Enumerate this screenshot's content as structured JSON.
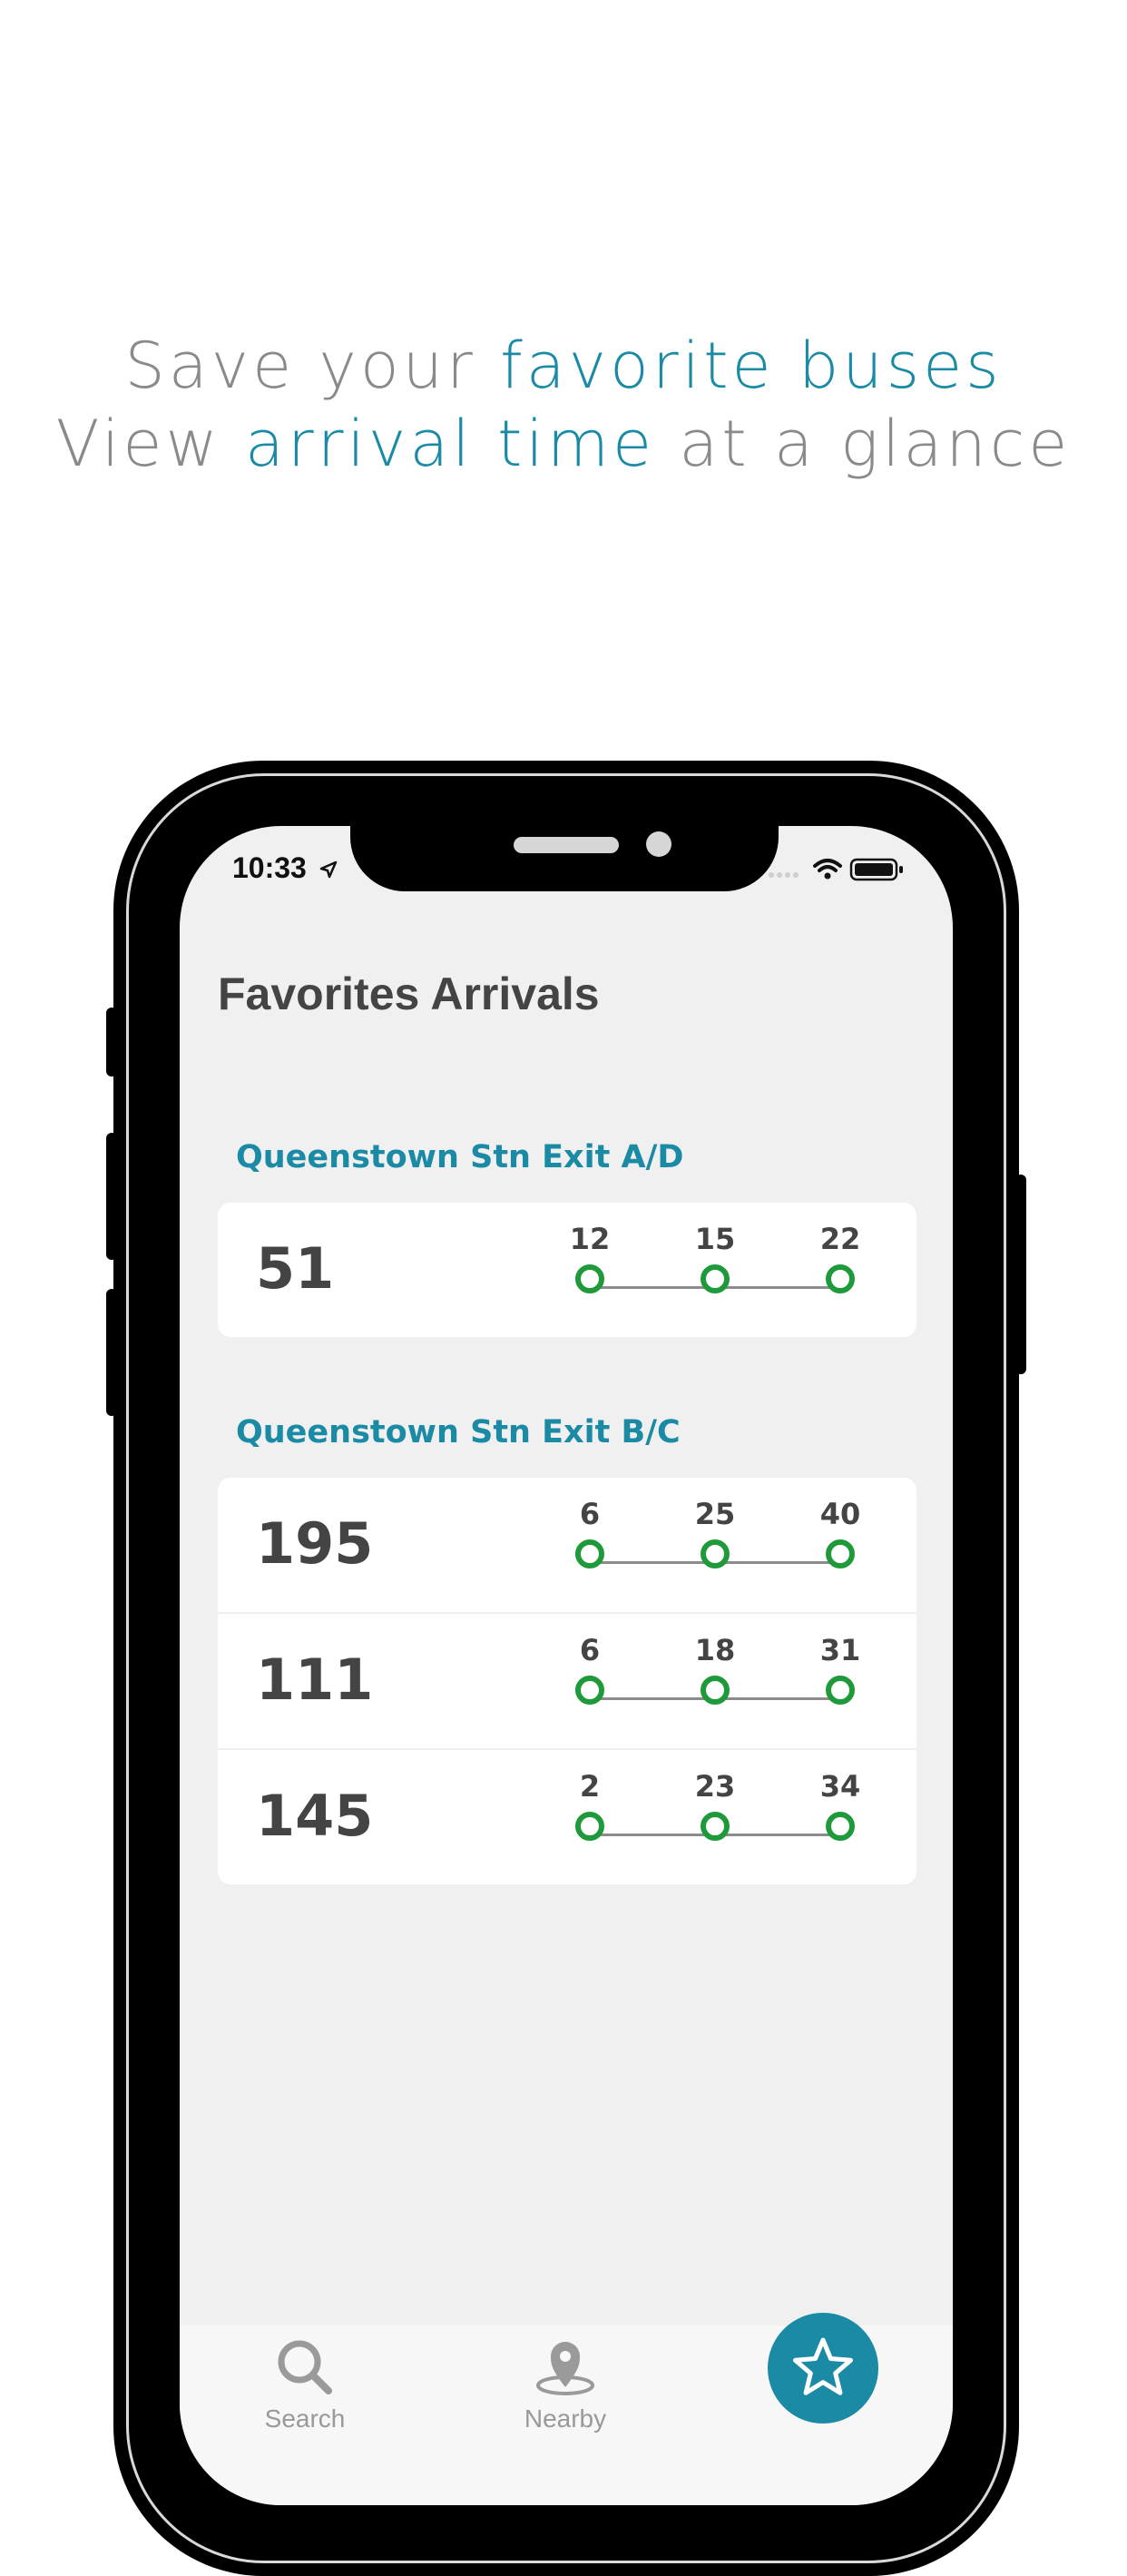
{
  "headline": {
    "line1_pre": "Save your ",
    "line1_hl": "favorite buses",
    "line2_pre": "View ",
    "line2_hl": "arrival time",
    "line2_post": " at a glance"
  },
  "status_bar": {
    "time": "10:33"
  },
  "screen": {
    "title": "Favorites Arrivals",
    "groups": [
      {
        "label": "Queenstown Stn Exit A/D",
        "buses": [
          {
            "number": "51",
            "arrivals": [
              "12",
              "15",
              "22"
            ]
          }
        ]
      },
      {
        "label": "Queenstown Stn Exit B/C",
        "buses": [
          {
            "number": "195",
            "arrivals": [
              "6",
              "25",
              "40"
            ]
          },
          {
            "number": "111",
            "arrivals": [
              "6",
              "18",
              "31"
            ]
          },
          {
            "number": "145",
            "arrivals": [
              "2",
              "23",
              "34"
            ]
          }
        ]
      }
    ]
  },
  "tabbar": {
    "search_label": "Search",
    "nearby_label": "Nearby",
    "favorites_icon": "star-icon"
  },
  "colors": {
    "accent": "#1a8aa5",
    "arrival_dot": "#1f9a3a",
    "text_dark": "#444444"
  }
}
